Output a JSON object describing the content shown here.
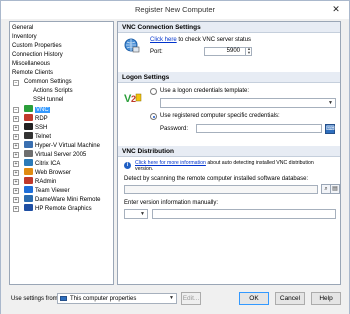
{
  "window": {
    "title": "Register New Computer",
    "close_glyph": "✕"
  },
  "tree": {
    "items": [
      {
        "label": "General"
      },
      {
        "label": "Inventory"
      },
      {
        "label": "Custom Properties"
      },
      {
        "label": "Connection History"
      },
      {
        "label": "Miscellaneous"
      },
      {
        "label": "Remote Clients"
      },
      {
        "label": "Common Settings"
      },
      {
        "label": "Actions Scripts"
      },
      {
        "label": "SSH tunnel"
      },
      {
        "label": "VNC"
      },
      {
        "label": "RDP"
      },
      {
        "label": "SSH"
      },
      {
        "label": "Telnet"
      },
      {
        "label": "Hyper-V Virtual Machine"
      },
      {
        "label": "Virtual Server 2005"
      },
      {
        "label": "Citrix ICA"
      },
      {
        "label": "Web Browser"
      },
      {
        "label": "RAdmin"
      },
      {
        "label": "Team Viewer"
      },
      {
        "label": "DameWare Mini Remote"
      },
      {
        "label": "HP Remote Graphics"
      }
    ],
    "expander_minus": "−",
    "expander_plus": "+",
    "client_icon_colors": [
      "#2b9e3a",
      "#c0392b",
      "#222222",
      "#333333",
      "#3a6fb0",
      "#6e6e6e",
      "#2a7ab8",
      "#e08a10",
      "#c0392b",
      "#1e6fd9",
      "#2b6cb0",
      "#1f4fa3"
    ]
  },
  "vnc_connection": {
    "header": "VNC Connection Settings",
    "link": "Click here",
    "link_suffix": " to check VNC server status",
    "port_label": "Port:",
    "port_value": "5900"
  },
  "logon": {
    "header": "Logon Settings",
    "template_option": "Use a logon credentials template:",
    "specific_option": "Use registered computer specific credentials:",
    "password_label": "Password:",
    "password_value": ""
  },
  "distribution": {
    "header": "VNC Distribution",
    "info_link": "Click here for more information",
    "info_text": " about auto detecting installed VNC distribution",
    "info_text2": "version.",
    "detect_label": "Detect by scanning the remote computer installed software database:",
    "manual_label": "Enter version information manually:",
    "detect_value": "",
    "manual_value": ""
  },
  "footer": {
    "use_settings_label": "Use settings from:",
    "settings_value": "This computer properties",
    "edit_label": "Edit...",
    "ok_label": "OK",
    "cancel_label": "Cancel",
    "help_label": "Help"
  }
}
